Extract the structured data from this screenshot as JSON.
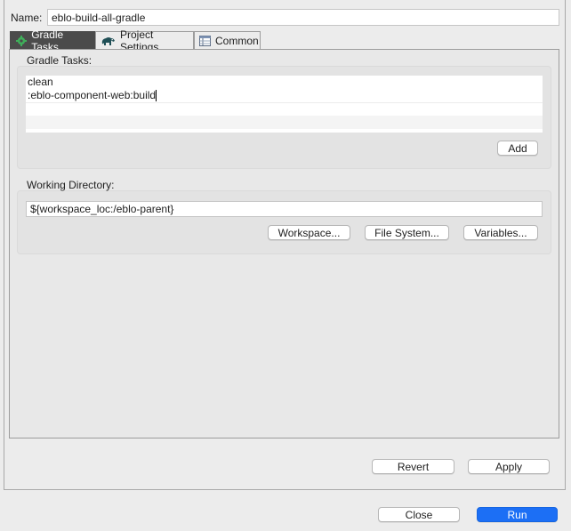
{
  "name": {
    "label": "Name:",
    "value": "eblo-build-all-gradle"
  },
  "tabs": [
    {
      "label": "Gradle Tasks",
      "icon": "gear-icon",
      "active": true
    },
    {
      "label": "Project Settings",
      "icon": "elephant-icon",
      "active": false
    },
    {
      "label": "Common",
      "icon": "table-icon",
      "active": false
    }
  ],
  "gradle_tasks": {
    "label": "Gradle Tasks:",
    "items": [
      "clean",
      ":eblo-component-web:build"
    ],
    "add_label": "Add"
  },
  "working_directory": {
    "label": "Working Directory:",
    "value": "${workspace_loc:/eblo-parent}",
    "workspace_label": "Workspace...",
    "filesystem_label": "File System...",
    "variables_label": "Variables..."
  },
  "actions": {
    "revert_label": "Revert",
    "apply_label": "Apply"
  },
  "dialog": {
    "close_label": "Close",
    "run_label": "Run"
  },
  "colors": {
    "accent": "#1c6ff5",
    "active_tab": "#4b4b4b"
  }
}
